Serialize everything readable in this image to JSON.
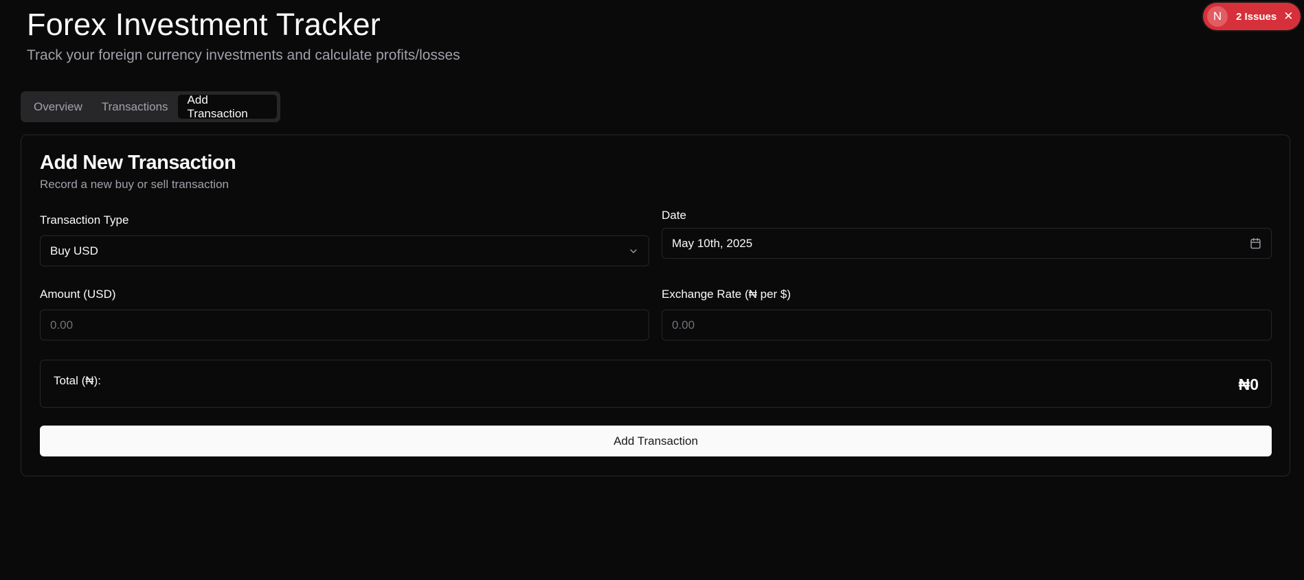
{
  "header": {
    "title": "Forex Investment Tracker",
    "subtitle": "Track your foreign currency investments and calculate profits/losses"
  },
  "issues_badge": {
    "logo_letter": "N",
    "label": "2 Issues",
    "close_glyph": "✕",
    "color": "#d6303a"
  },
  "tabs": [
    {
      "label": "Overview",
      "active": false
    },
    {
      "label": "Transactions",
      "active": false
    },
    {
      "label": "Add Transaction",
      "active": true
    }
  ],
  "form": {
    "title": "Add New Transaction",
    "description": "Record a new buy or sell transaction",
    "transaction_type": {
      "label": "Transaction Type",
      "value": "Buy USD",
      "icon": "chevron-down-icon"
    },
    "date": {
      "label": "Date",
      "value": "May 10th, 2025",
      "icon": "calendar-icon"
    },
    "amount": {
      "label": "Amount (USD)",
      "placeholder": "0.00"
    },
    "exchange_rate": {
      "label": "Exchange Rate (₦ per $)",
      "placeholder": "0.00"
    },
    "total": {
      "label": "Total (₦):",
      "value": "₦0"
    },
    "submit_label": "Add Transaction"
  },
  "colors": {
    "background": "#0a0a0a",
    "border": "#27272a",
    "muted_text": "#a1a1aa",
    "primary_button": "#fafafa"
  }
}
